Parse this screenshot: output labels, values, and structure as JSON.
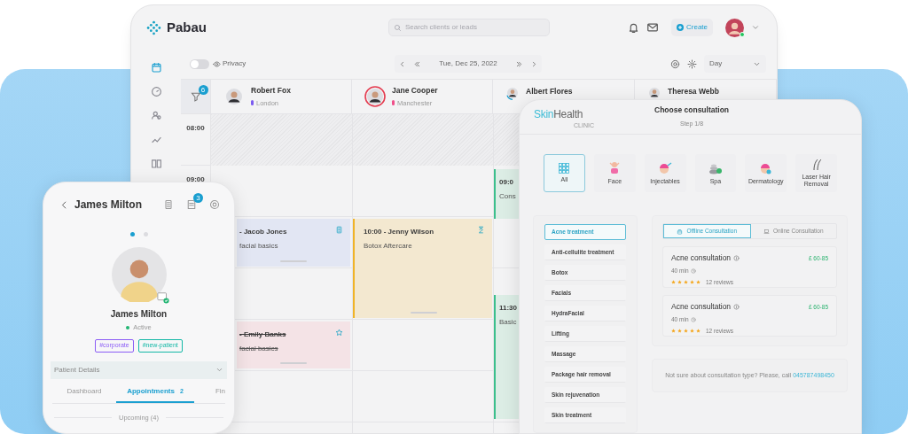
{
  "app": {
    "logo": "Pabau",
    "search_placeholder": "Search clients or leads",
    "create_button": "Create"
  },
  "sidebar": [
    {
      "selected": true
    },
    {
      "selected": false
    },
    {
      "selected": false
    },
    {
      "selected": false
    },
    {
      "selected": false
    }
  ],
  "toolbar": {
    "privacy_label": "Privacy",
    "privacy_on": false,
    "date": "Tue, Dec 25, 2022",
    "view": "Day"
  },
  "filter_badge": "6",
  "staff": [
    {
      "name": "Robert Fox",
      "location": "London",
      "color": "#7c5cf0"
    },
    {
      "name": "Jane Cooper",
      "location": "Manchester",
      "color": "#f0508a"
    },
    {
      "name": "Albert Flores"
    },
    {
      "name": "Theresa Webb"
    }
  ],
  "times": [
    "08:00",
    "09:00"
  ],
  "appointments": [
    {
      "title": "- Jacob Jones",
      "service": "facial basics",
      "color": "#e2e6f3",
      "cancelled": false
    },
    {
      "title": "10:00 - Jenny Wilson",
      "service": "Botox Aftercare",
      "color": "#f3e8d0",
      "cancelled": false
    },
    {
      "title": "- Emily Banks",
      "service": "facial basics",
      "color": "#f4e3e6",
      "cancelled": true
    },
    {
      "title": "09:0",
      "service": "Cons",
      "color": "#dcede5",
      "cancelled": false
    },
    {
      "title": "11:30",
      "service": "Basic",
      "color": "#dcede5",
      "cancelled": false
    }
  ],
  "phone": {
    "title": "James Milton",
    "notes_badge": "3",
    "pager": [
      {
        "selected": true
      },
      {
        "selected": false
      }
    ],
    "name": "James Milton",
    "status": "Active",
    "tags": [
      {
        "label": "#corporate",
        "color": "#8b5cf6"
      },
      {
        "label": "#new-patient",
        "color": "#14b8a6"
      }
    ],
    "section": "Patient Details",
    "tabs": [
      {
        "label": "Dashboard",
        "selected": false
      },
      {
        "label": "Appointments",
        "count": "2",
        "selected": true
      },
      {
        "label": "Fin",
        "selected": false
      }
    ],
    "upcoming": "Upcoming (4)"
  },
  "booking": {
    "logo_first": "Skin",
    "logo_second": "Health",
    "logo_sub": "CLINIC",
    "title": "Choose consultation",
    "step": "Step 1/8",
    "categories": [
      {
        "label": "All",
        "selected": true
      },
      {
        "label": "Face",
        "selected": false
      },
      {
        "label": "Injectables",
        "selected": false
      },
      {
        "label": "Spa",
        "selected": false
      },
      {
        "label": "Dermatology",
        "selected": false
      },
      {
        "label": "Laser Hair Removal",
        "selected": false
      }
    ],
    "treatments": [
      {
        "label": "Acne treatment",
        "selected": true
      },
      {
        "label": "Anti-cellulite treatment",
        "selected": false
      },
      {
        "label": "Botox",
        "selected": false
      },
      {
        "label": "Facials",
        "selected": false
      },
      {
        "label": "HydraFacial",
        "selected": false
      },
      {
        "label": "Lifting",
        "selected": false
      },
      {
        "label": "Massage",
        "selected": false
      },
      {
        "label": "Package hair removal",
        "selected": false
      },
      {
        "label": "Skin rejuvenation",
        "selected": false
      },
      {
        "label": "Skin treatment",
        "selected": false
      }
    ],
    "modes": [
      {
        "label": "Offline Consultation",
        "selected": true
      },
      {
        "label": "Online Consultation",
        "selected": false
      }
    ],
    "cards": [
      {
        "title": "Acne consultation",
        "price": "£ 60-85",
        "duration": "40 min",
        "stars": 5,
        "reviews": "12 reviews"
      },
      {
        "title": "Acne consultation",
        "price": "£ 60-85",
        "duration": "40 min",
        "stars": 5,
        "reviews": "12 reviews"
      }
    ],
    "footer": "Not sure about consultation type? Please, call",
    "phone_link": "045787498450"
  }
}
